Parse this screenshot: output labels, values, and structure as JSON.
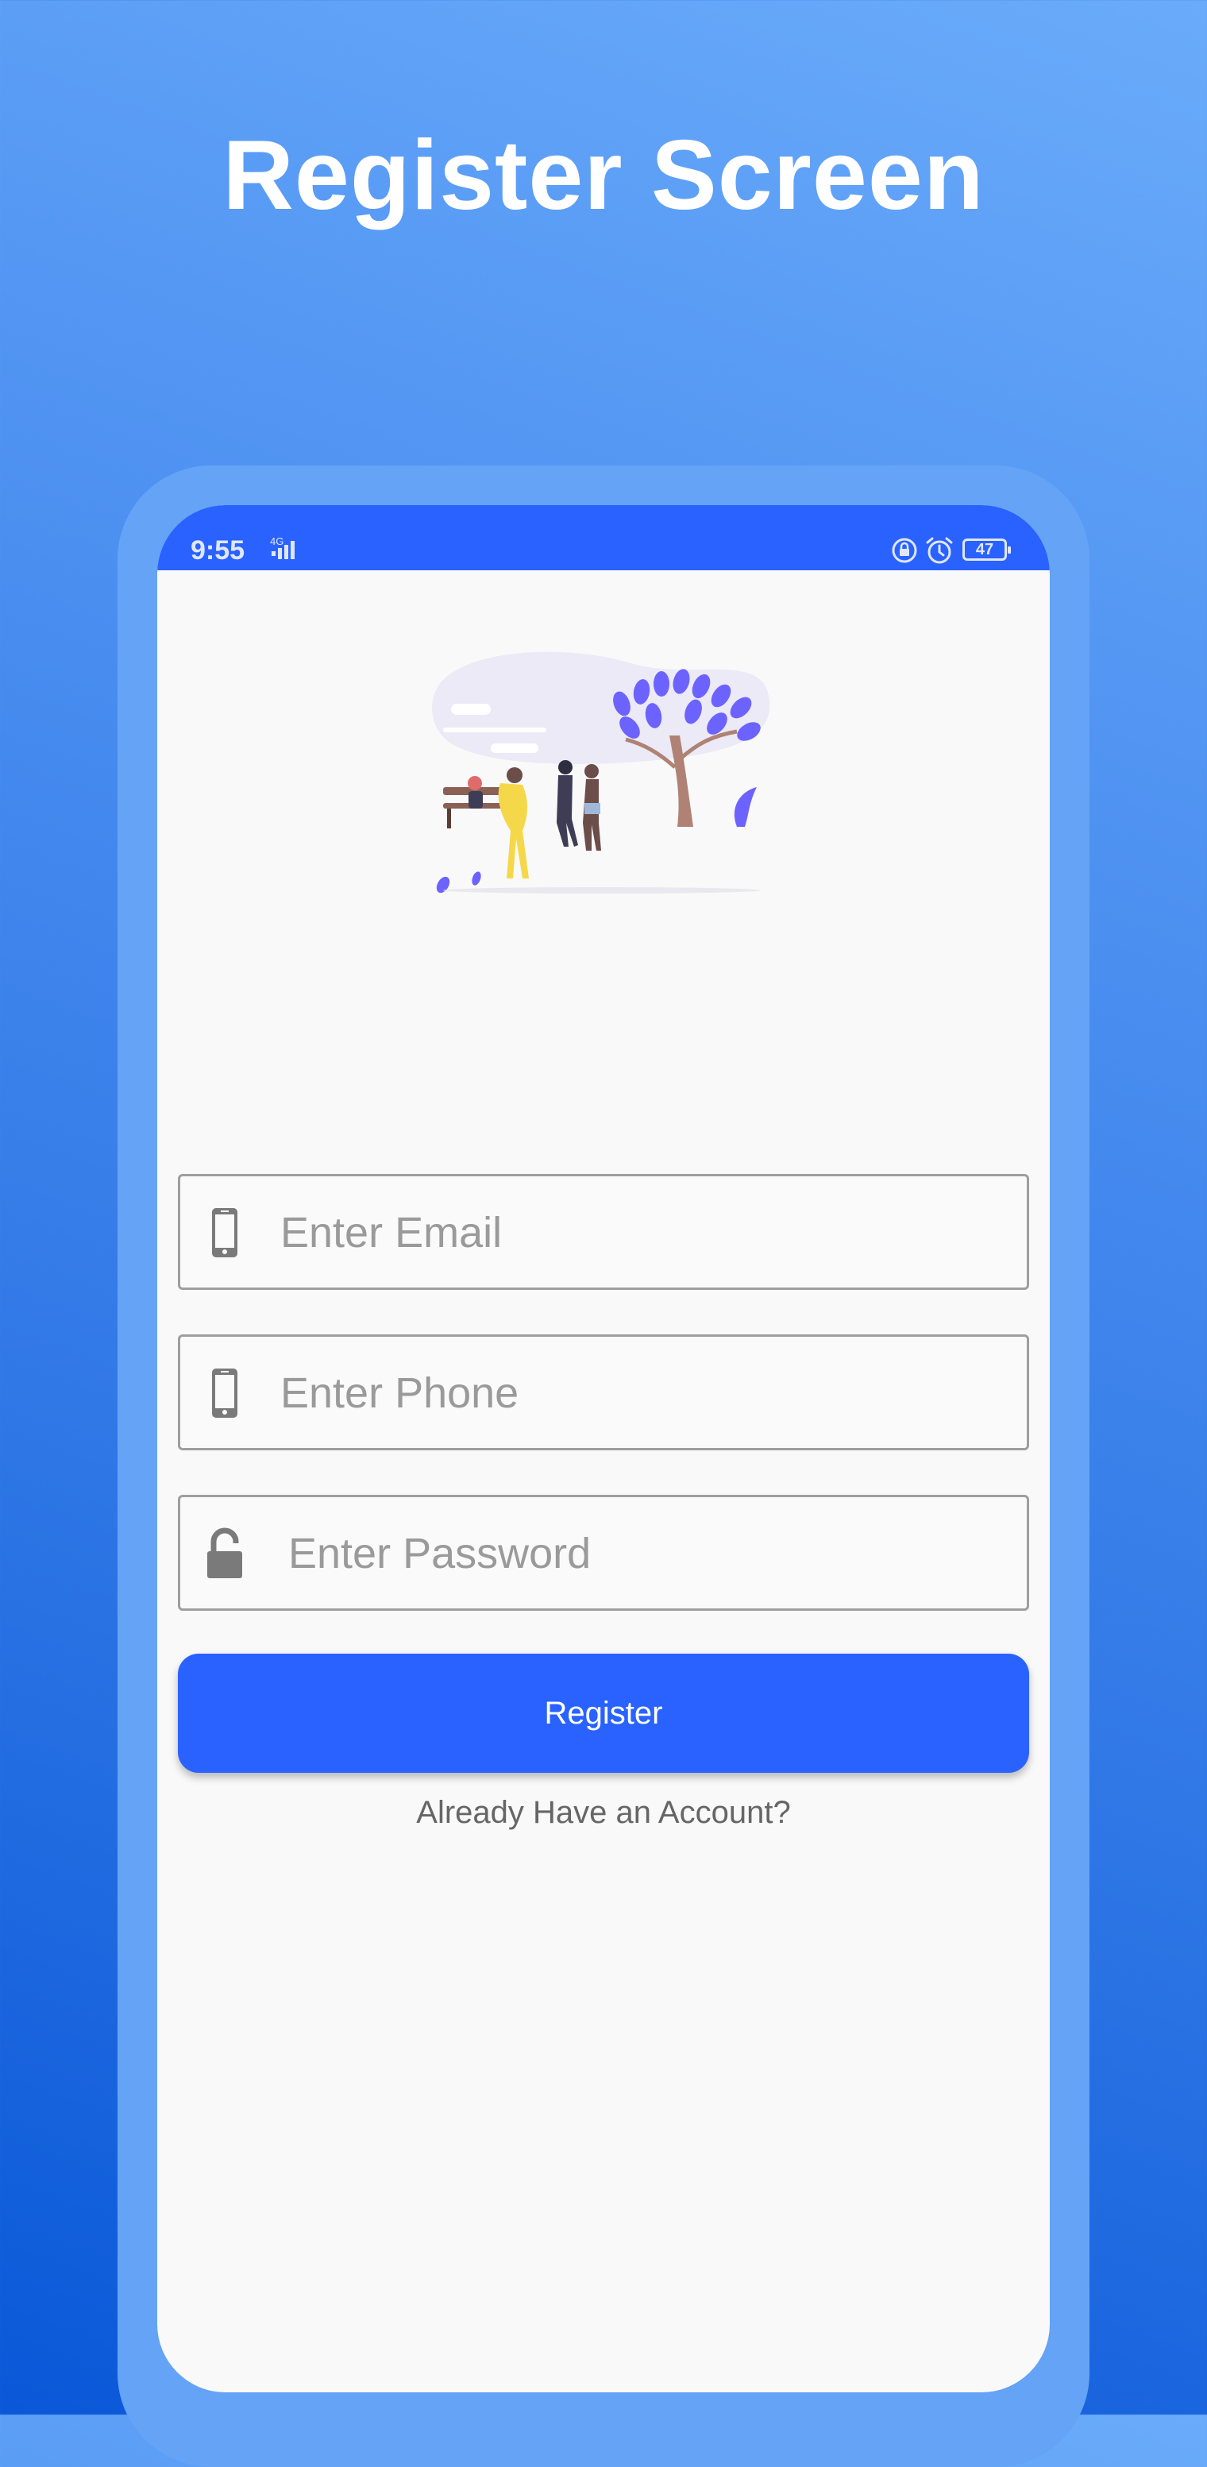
{
  "banner": {
    "title": "Register Screen"
  },
  "status_bar": {
    "time": "9:55",
    "network": "4G",
    "battery": "47",
    "icons": [
      "signal-icon",
      "lock-rotate-icon",
      "alarm-icon",
      "battery-icon"
    ],
    "background": "#2962ff"
  },
  "illustration": {
    "icon": "park-people-illustration"
  },
  "form": {
    "email": {
      "placeholder": "Enter Email",
      "value": "",
      "icon": "phone-icon"
    },
    "phone": {
      "placeholder": "Enter Phone",
      "value": "",
      "icon": "phone-icon"
    },
    "password": {
      "placeholder": "Enter Password",
      "value": "",
      "icon": "unlock-icon"
    },
    "register_label": "Register",
    "login_link": "Already Have an Account?"
  },
  "colors": {
    "accent": "#2962ff",
    "frame": "#64a3f6",
    "screen_background": "#f9f9f9",
    "field_border": "#9e9e9e",
    "placeholder": "#9a9a9a",
    "icon": "#7a7a7a"
  }
}
